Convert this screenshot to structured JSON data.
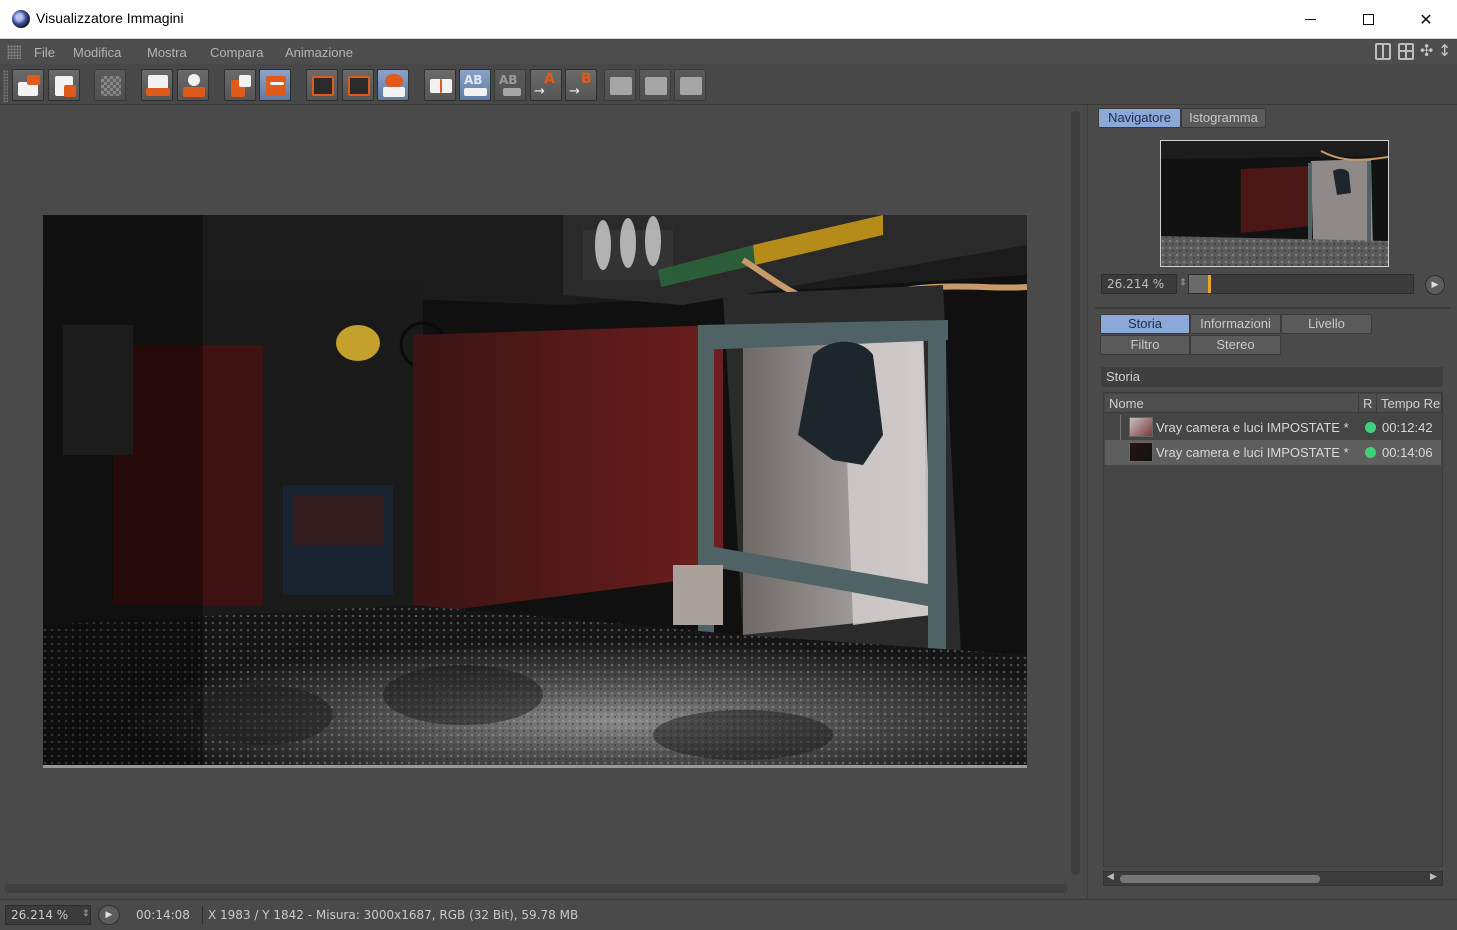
{
  "window": {
    "title": "Visualizzatore Immagini"
  },
  "menu": [
    "File",
    "Modifica",
    "Mostra",
    "Compara",
    "Animazione"
  ],
  "toolbar": {
    "ab_labels": [
      "A",
      "B",
      "AB",
      "AB"
    ]
  },
  "right_panel": {
    "top_tabs": [
      "Navigatore",
      "Istogramma"
    ],
    "active_top_tab": "Navigatore",
    "zoom": "26.214 %",
    "zoom_fraction": 0.1,
    "bottom_tabs": [
      "Storia",
      "Informazioni",
      "Livello",
      "Filtro",
      "Stereo"
    ],
    "active_bottom_tab": "Storia",
    "section_title": "Storia",
    "columns": [
      "Nome",
      "R",
      "Tempo Re"
    ],
    "rows": [
      {
        "name": "Vray camera e luci IMPOSTATE *",
        "time": "00:12:42",
        "status": "green"
      },
      {
        "name": "Vray camera e luci IMPOSTATE *",
        "time": "00:14:06",
        "status": "green",
        "selected": true
      }
    ]
  },
  "status": {
    "zoom": "26.214 %",
    "time": "00:14:08",
    "info": "X 1983 / Y 1842 - Misura: 3000x1687, RGB (32 Bit), 59.78 MB"
  },
  "colors": {
    "accent": "#8aa9d8",
    "status_green": "#3fd27a",
    "toolbar_orange": "#e05a1c"
  }
}
